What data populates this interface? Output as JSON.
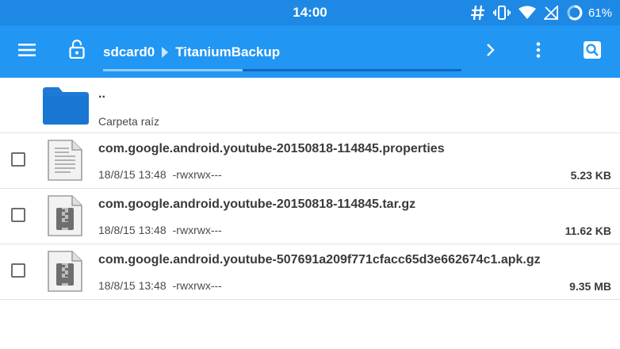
{
  "status_bar": {
    "time": "14:00",
    "battery_percent": "61%",
    "icons": [
      "hash-icon",
      "vibrate-icon",
      "wifi-icon",
      "no-sim-icon",
      "battery-ring-icon"
    ]
  },
  "toolbar": {
    "breadcrumbs": [
      "sdcard0",
      "TitaniumBackup"
    ],
    "path_progress": 0.39,
    "icons": [
      "menu-icon",
      "lock-open-icon",
      "chevron-right-icon",
      "more-vert-icon",
      "search-icon"
    ]
  },
  "files": [
    {
      "name": "..",
      "subtitle": "Carpeta raíz",
      "icon": "folder-icon"
    },
    {
      "name": "com.google.android.youtube-20150818-114845.properties",
      "date": "18/8/15 13:48",
      "perms": "-rwxrwx---",
      "size": "5.23 KB",
      "icon": "text-file-icon"
    },
    {
      "name": "com.google.android.youtube-20150818-114845.tar.gz",
      "date": "18/8/15 13:48",
      "perms": "-rwxrwx---",
      "size": "11.62 KB",
      "icon": "archive-file-icon"
    },
    {
      "name": "com.google.android.youtube-507691a209f771cfacc65d3e662674c1.apk.gz",
      "date": "18/8/15 13:48",
      "perms": "-rwxrwx---",
      "size": "9.35 MB",
      "icon": "archive-file-icon"
    }
  ],
  "colors": {
    "status_bar": "#1e88e5",
    "toolbar": "#2196f3",
    "folder": "#1e7ad6"
  }
}
